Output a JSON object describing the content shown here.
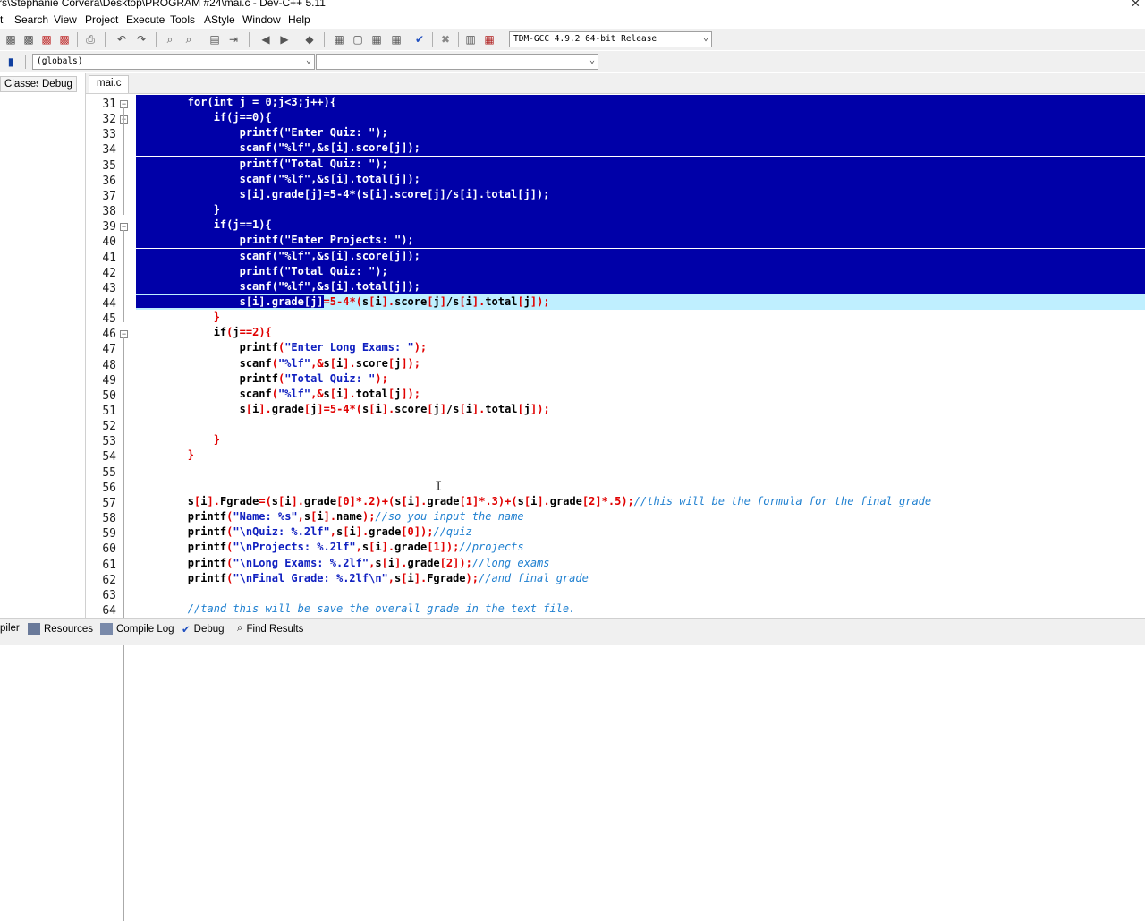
{
  "window": {
    "title": "rs\\Stephanie Corvera\\Desktop\\PROGRAM #24\\mai.c - Dev-C++ 5.11",
    "minimize": "—",
    "close": "✕"
  },
  "menu": [
    "t",
    "Search",
    "View",
    "Project",
    "Execute",
    "Tools",
    "AStyle",
    "Window",
    "Help"
  ],
  "toolbar": {
    "compiler": "TDM-GCC 4.9.2 64-bit Release"
  },
  "toolbar2": {
    "scope": "(globals)",
    "member": ""
  },
  "left_tabs": [
    "Classes",
    "Debug"
  ],
  "editor_tab": "mai.c",
  "status_tabs": [
    "piler",
    "Resources",
    "Compile Log",
    "Debug",
    "Find Results"
  ],
  "code_lines": [
    {
      "n": "31",
      "text": "        for(int j = 0;j<3;j++){"
    },
    {
      "n": "32",
      "text": "            if(j==0){"
    },
    {
      "n": "33",
      "text": "                printf(\"Enter Quiz: \");"
    },
    {
      "n": "34",
      "text": "                scanf(\"%lf\",&s[i].score[j]);"
    },
    {
      "n": "35",
      "text": "                printf(\"Total Quiz: \");"
    },
    {
      "n": "36",
      "text": "                scanf(\"%lf\",&s[i].total[j]);"
    },
    {
      "n": "37",
      "text": "                s[i].grade[j]=5-4*(s[i].score[j]/s[i].total[j]);"
    },
    {
      "n": "38",
      "text": "            }"
    },
    {
      "n": "39",
      "text": "            if(j==1){"
    },
    {
      "n": "40",
      "text": "                printf(\"Enter Projects: \");"
    },
    {
      "n": "41",
      "text": "                scanf(\"%lf\",&s[i].score[j]);"
    },
    {
      "n": "42",
      "text": "                printf(\"Total Quiz: \");"
    },
    {
      "n": "43",
      "text": "                scanf(\"%lf\",&s[i].total[j]);"
    },
    {
      "n": "44",
      "text": "                s[i].grade[j]=5-4*(s[i].score[j]/s[i].total[j]);"
    },
    {
      "n": "45",
      "text": "            }"
    },
    {
      "n": "46",
      "text": "            if(j==2){"
    },
    {
      "n": "47",
      "text": "                printf(\"Enter Long Exams: \");"
    },
    {
      "n": "48",
      "text": "                scanf(\"%lf\",&s[i].score[j]);"
    },
    {
      "n": "49",
      "text": "                printf(\"Total Quiz: \");"
    },
    {
      "n": "50",
      "text": "                scanf(\"%lf\",&s[i].total[j]);"
    },
    {
      "n": "51",
      "text": "                s[i].grade[j]=5-4*(s[i].score[j]/s[i].total[j]);"
    },
    {
      "n": "52",
      "text": ""
    },
    {
      "n": "53",
      "text": "            }"
    },
    {
      "n": "54",
      "text": "        }"
    },
    {
      "n": "55",
      "text": ""
    },
    {
      "n": "56",
      "text": ""
    },
    {
      "n": "57",
      "text": "        s[i].Fgrade=(s[i].grade[0]*.2)+(s[i].grade[1]*.3)+(s[i].grade[2]*.5);//this will be the formula for the final grade"
    },
    {
      "n": "58",
      "text": "        printf(\"Name: %s\",s[i].name);//so you input the name"
    },
    {
      "n": "59",
      "text": "        printf(\"\\nQuiz: %.2lf\",s[i].grade[0]);//quiz"
    },
    {
      "n": "60",
      "text": "        printf(\"\\nProjects: %.2lf\",s[i].grade[1]);//projects"
    },
    {
      "n": "61",
      "text": "        printf(\"\\nLong Exams: %.2lf\",s[i].grade[2]);//long exams"
    },
    {
      "n": "62",
      "text": "        printf(\"\\nFinal Grade: %.2lf\\n\",s[i].Fgrade);//and final grade"
    },
    {
      "n": "63",
      "text": ""
    },
    {
      "n": "64",
      "text": "        //tand this will be save the overall grade in the text file."
    }
  ]
}
